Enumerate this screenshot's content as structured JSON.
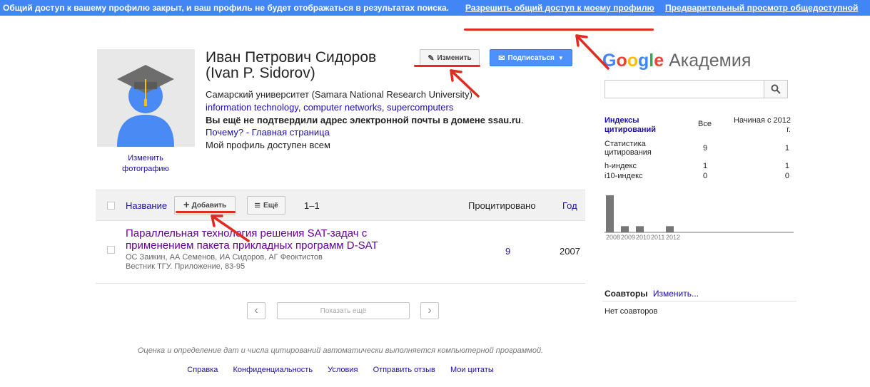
{
  "topbar": {
    "message": "Общий доступ к вашему профилю закрыт, и ваш профиль не будет отображаться в результатах поиска.",
    "allow_link": "Разрешить общий доступ к моему профилю",
    "preview_link": "Предварительный просмотр общедоступной"
  },
  "profile": {
    "name_line1": "Иван Петрович Сидоров",
    "name_line2": "(Ivan P. Sidorov)",
    "change_photo": "Изменить фотографию",
    "affiliation": "Самарский университет (Samara National Research University)",
    "interests": [
      "information technology",
      "computer networks",
      "supercomputers"
    ],
    "email_warning": "Вы ещё не подтвердили адрес электронной почты в домене ssau.ru",
    "email_warning_end": ".",
    "why": "Почему?",
    "sep": " - ",
    "homepage": "Главная страница",
    "visibility": "Мой профиль доступен всем",
    "edit_button": "Изменить",
    "follow_button": "Подписаться"
  },
  "articles": {
    "headers": {
      "title": "Название",
      "add": "Добавить",
      "more": "Ещё",
      "range": "1–1",
      "cited": "Процитировано",
      "year": "Год"
    },
    "rows": [
      {
        "title_line1": "Параллельная технология решения SAT-задач с",
        "title_line2": "применением пакета прикладных программ D-SAT",
        "authors": "ОС Заикин, АА Семенов, ИА Сидоров, АГ Феоктистов",
        "venue": "Вестник ТГУ. Приложение, 83-95",
        "cited": "9",
        "year": "2007"
      }
    ],
    "show_more": "Показать ещё",
    "prev_icon": "‹",
    "next_icon": "›"
  },
  "footer": {
    "note": "Оценка и определение дат и числа цитирований автоматически выполняется компьютерной программой.",
    "links": [
      "Справка",
      "Конфиденциальность",
      "Условия",
      "Отправить отзыв",
      "Мои цитаты"
    ]
  },
  "sidebar": {
    "logo_google": "Google",
    "logo_suffix": "Академия",
    "search_value": "",
    "metrics": {
      "header": [
        "Индексы цитирований",
        "Все",
        "Начиная с 2012 г."
      ],
      "rows": [
        [
          "Статистика цитирования",
          "9",
          "1"
        ],
        [
          "h-индекс",
          "1",
          "1"
        ],
        [
          "i10-индекс",
          "0",
          "0"
        ]
      ]
    },
    "chart_years": [
      "2008",
      "2009",
      "2010",
      "2011",
      "2012"
    ],
    "coauthors_title": "Соавторы",
    "coauthors_edit": "Изменить...",
    "no_coauthors": "Нет соавторов"
  },
  "colors": {
    "topbar": "#4285f4",
    "accent_red": "#e02b20",
    "link": "#1a0dab",
    "article_title": "#660099",
    "follow_button": "#4d90fe"
  },
  "chart_data": {
    "type": "bar",
    "categories": [
      "2008",
      "2009",
      "2010",
      "2011",
      "2012"
    ],
    "values": [
      6,
      1,
      1,
      0,
      1
    ]
  }
}
